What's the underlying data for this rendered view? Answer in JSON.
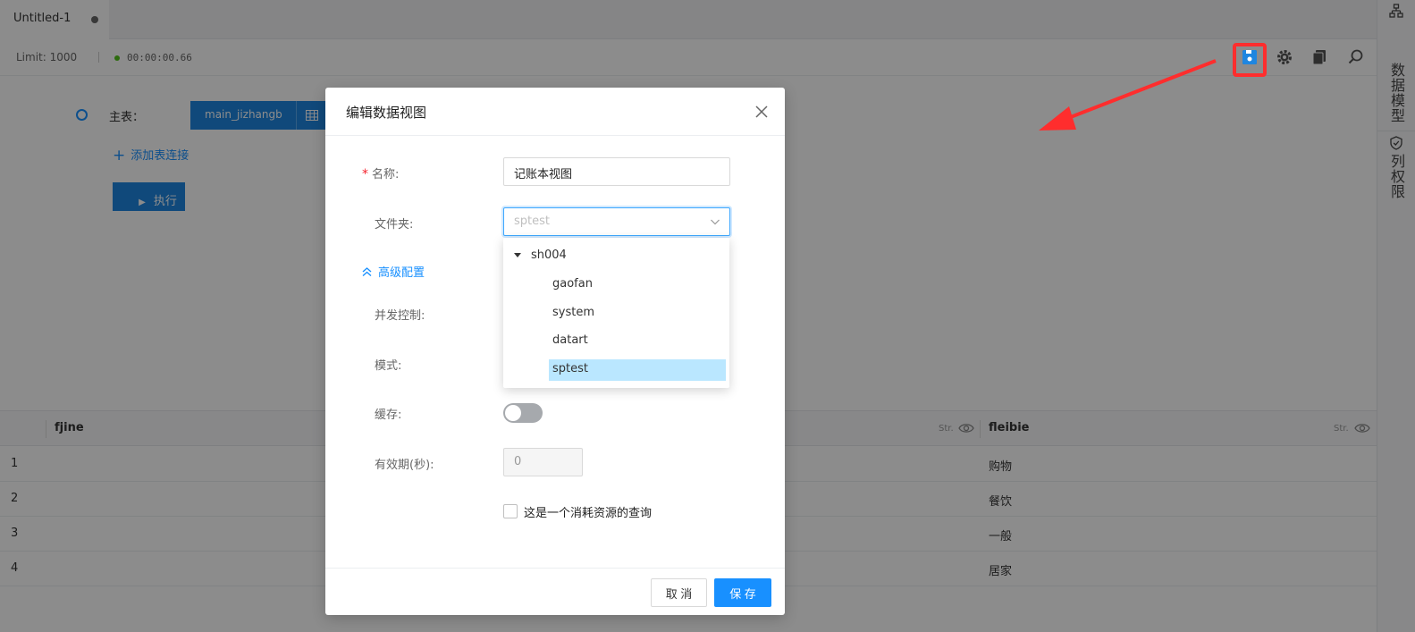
{
  "tab": {
    "title": "Untitled-1"
  },
  "toolbar": {
    "limit": "Limit: 1000",
    "elapsed": "00:00:00.66"
  },
  "sidepanel": {
    "data_model": "数据模型",
    "column_perm": "列权限"
  },
  "builder": {
    "main_table_label": "主表：",
    "main_table_name": "main_jizhangb",
    "add_join": "添加表连接",
    "run": "执行"
  },
  "grid": {
    "columns": [
      {
        "name": "fjine",
        "type": "Str."
      },
      {
        "name": "fleibie",
        "type": "Str."
      }
    ],
    "rows": [
      {
        "idx": "1",
        "fleibie": "购物"
      },
      {
        "idx": "2",
        "fleibie": "餐饮"
      },
      {
        "idx": "3",
        "fleibie": "一般"
      },
      {
        "idx": "4",
        "fleibie": "居家"
      }
    ]
  },
  "modal": {
    "title": "编辑数据视图",
    "name_label": "名称:",
    "name_value": "记账本视图",
    "folder_label": "文件夹:",
    "folder_placeholder": "sptest",
    "advanced": "高级配置",
    "concurrency_label": "并发控制:",
    "mode_label": "模式:",
    "cache_label": "缓存:",
    "ttl_label": "有效期(秒):",
    "ttl_value": "0",
    "heavy_query": "这是一个消耗资源的查询",
    "cancel": "取 消",
    "save": "保 存"
  },
  "folder_tree": {
    "root": "sh004",
    "children": [
      "gaofan",
      "system",
      "datart",
      "sptest"
    ],
    "selected": "sptest"
  },
  "colors": {
    "primary": "#1890ff",
    "chip": "#1e86e0",
    "highlight": "#ff2d2d",
    "selected_bg": "#bae7ff"
  }
}
